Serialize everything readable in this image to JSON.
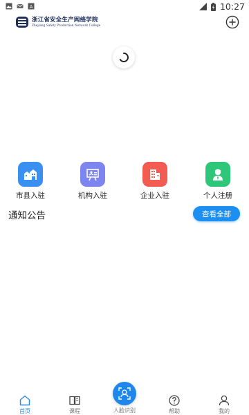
{
  "status_bar": {
    "time": "10:27",
    "left_icons": [
      "image-icon",
      "mail-icon",
      "a-icon"
    ],
    "right_icons": [
      "signal-icon",
      "battery-icon"
    ]
  },
  "header": {
    "logo_name": "浙江省安全生产网络学院",
    "logo_subtitle": "Zhejiang Safety Production Network College",
    "add_icon": "plus-circle-icon"
  },
  "entries": [
    {
      "label": "市县入驻",
      "icon": "city-icon",
      "color": "#3a90f0"
    },
    {
      "label": "机构入驻",
      "icon": "institution-icon",
      "color": "#7d86f0"
    },
    {
      "label": "企业入驻",
      "icon": "enterprise-icon",
      "color": "#f25c52"
    },
    {
      "label": "个人注册",
      "icon": "person-icon",
      "color": "#2ec77a"
    }
  ],
  "notice": {
    "title": "通知公告",
    "see_all": "查看全部"
  },
  "bottom_nav": [
    {
      "label": "首页",
      "icon": "home-icon",
      "active": true
    },
    {
      "label": "课程",
      "icon": "book-icon",
      "active": false
    },
    {
      "label": "人脸识别",
      "icon": "face-icon",
      "active": false
    },
    {
      "label": "帮助",
      "icon": "help-icon",
      "active": false
    },
    {
      "label": "我的",
      "icon": "user-icon",
      "active": false
    }
  ],
  "colors": {
    "accent": "#1d8ff0",
    "nav_active": "#2a88e6",
    "nav_inactive": "#777777"
  }
}
